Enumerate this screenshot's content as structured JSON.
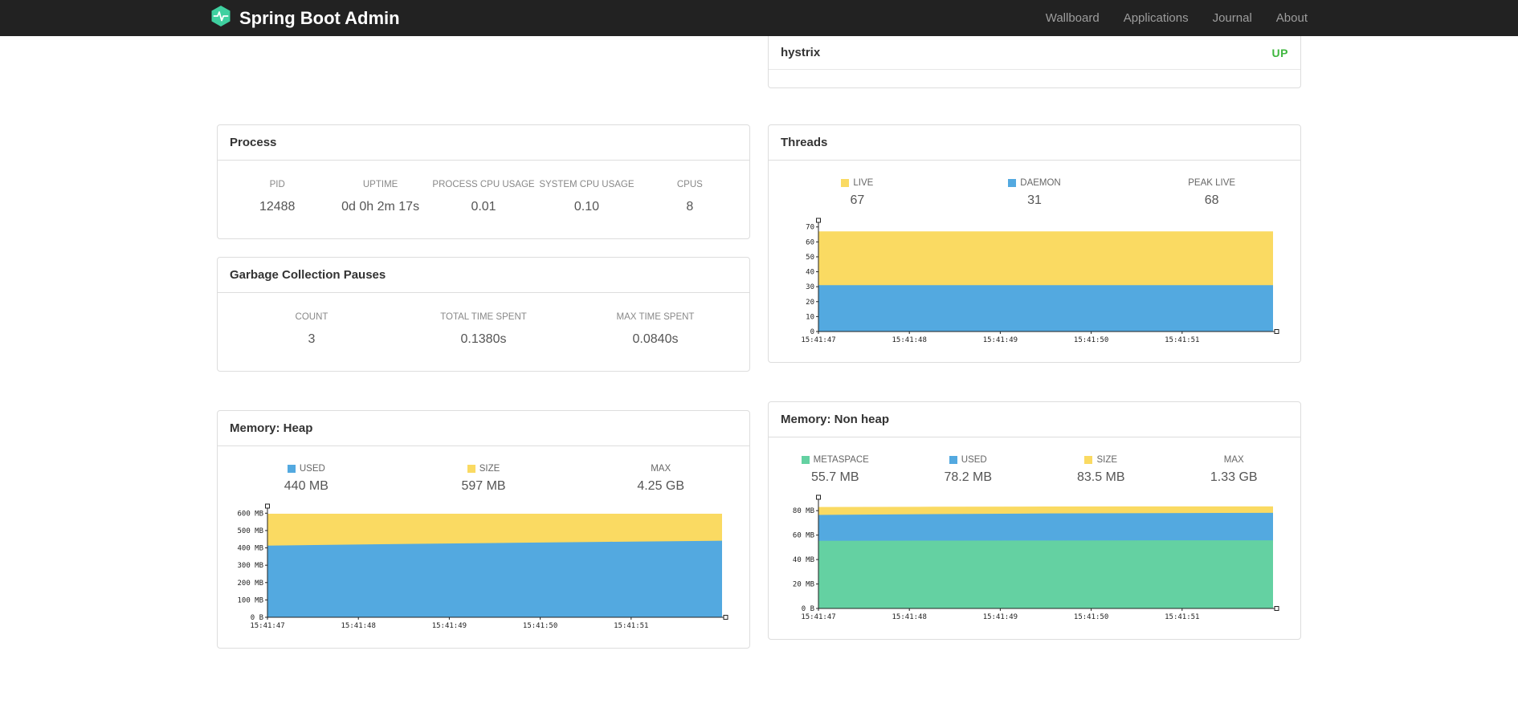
{
  "colors": {
    "yellow": "#fada62",
    "blue": "#53a9e0",
    "green": "#64d1a2",
    "up": "#3fb73f",
    "brand": "#3fd0a0"
  },
  "navbar": {
    "brand": "Spring Boot Admin",
    "links": [
      {
        "label": "Wallboard"
      },
      {
        "label": "Applications"
      },
      {
        "label": "Journal"
      },
      {
        "label": "About"
      }
    ]
  },
  "health": {
    "service": "hystrix",
    "status": "UP"
  },
  "process": {
    "title": "Process",
    "stats": [
      {
        "label": "PID",
        "value": "12488"
      },
      {
        "label": "UPTIME",
        "value": "0d 0h 2m 17s"
      },
      {
        "label": "PROCESS CPU USAGE",
        "value": "0.01"
      },
      {
        "label": "SYSTEM CPU USAGE",
        "value": "0.10"
      },
      {
        "label": "CPUS",
        "value": "8"
      }
    ]
  },
  "gc": {
    "title": "Garbage Collection Pauses",
    "stats": [
      {
        "label": "COUNT",
        "value": "3"
      },
      {
        "label": "TOTAL TIME SPENT",
        "value": "0.1380s"
      },
      {
        "label": "MAX TIME SPENT",
        "value": "0.0840s"
      }
    ]
  },
  "threads": {
    "title": "Threads",
    "legend": [
      {
        "label": "LIVE",
        "value": "67",
        "color": "#fada62"
      },
      {
        "label": "DAEMON",
        "value": "31",
        "color": "#53a9e0"
      },
      {
        "label": "PEAK LIVE",
        "value": "68"
      }
    ]
  },
  "memory_heap": {
    "title": "Memory: Heap",
    "legend": [
      {
        "label": "USED",
        "value": "440 MB",
        "color": "#53a9e0"
      },
      {
        "label": "SIZE",
        "value": "597 MB",
        "color": "#fada62"
      },
      {
        "label": "MAX",
        "value": "4.25 GB"
      }
    ]
  },
  "memory_nonheap": {
    "title": "Memory: Non heap",
    "legend": [
      {
        "label": "METASPACE",
        "value": "55.7 MB",
        "color": "#64d1a2"
      },
      {
        "label": "USED",
        "value": "78.2 MB",
        "color": "#53a9e0"
      },
      {
        "label": "SIZE",
        "value": "83.5 MB",
        "color": "#fada62"
      },
      {
        "label": "MAX",
        "value": "1.33 GB"
      }
    ]
  },
  "chart_data": [
    {
      "type": "area",
      "title": "Threads",
      "x": [
        "15:41:47",
        "15:41:48",
        "15:41:49",
        "15:41:50",
        "15:41:51"
      ],
      "ylim": [
        0,
        72
      ],
      "yticks": [
        {
          "v": 0,
          "label": "0"
        },
        {
          "v": 10,
          "label": "10"
        },
        {
          "v": 20,
          "label": "20"
        },
        {
          "v": 30,
          "label": "30"
        },
        {
          "v": 40,
          "label": "40"
        },
        {
          "v": 50,
          "label": "50"
        },
        {
          "v": 60,
          "label": "60"
        },
        {
          "v": 70,
          "label": "70"
        }
      ],
      "series": [
        {
          "name": "LIVE",
          "color": "#fada62",
          "values": [
            67,
            67,
            67,
            67,
            67
          ]
        },
        {
          "name": "DAEMON",
          "color": "#53a9e0",
          "values": [
            31,
            31,
            31,
            31,
            31
          ]
        }
      ]
    },
    {
      "type": "area",
      "title": "Memory: Heap",
      "x": [
        "15:41:47",
        "15:41:48",
        "15:41:49",
        "15:41:50",
        "15:41:51"
      ],
      "ylim": [
        0,
        620
      ],
      "yticks": [
        {
          "v": 0,
          "label": "0 B"
        },
        {
          "v": 100,
          "label": "100 MB"
        },
        {
          "v": 200,
          "label": "200 MB"
        },
        {
          "v": 300,
          "label": "300 MB"
        },
        {
          "v": 400,
          "label": "400 MB"
        },
        {
          "v": 500,
          "label": "500 MB"
        },
        {
          "v": 600,
          "label": "600 MB"
        }
      ],
      "series": [
        {
          "name": "SIZE",
          "color": "#fada62",
          "values": [
            597,
            597,
            597,
            597,
            597
          ]
        },
        {
          "name": "USED",
          "color": "#53a9e0",
          "values": [
            413,
            421,
            428,
            435,
            441
          ]
        }
      ]
    },
    {
      "type": "area",
      "title": "Memory: Non heap",
      "x": [
        "15:41:47",
        "15:41:48",
        "15:41:49",
        "15:41:50",
        "15:41:51"
      ],
      "ylim": [
        0,
        88
      ],
      "yticks": [
        {
          "v": 0,
          "label": "0 B"
        },
        {
          "v": 20,
          "label": "20 MB"
        },
        {
          "v": 40,
          "label": "40 MB"
        },
        {
          "v": 60,
          "label": "60 MB"
        },
        {
          "v": 80,
          "label": "80 MB"
        }
      ],
      "series": [
        {
          "name": "SIZE",
          "color": "#fada62",
          "values": [
            83,
            83.2,
            83.4,
            83.5,
            83.5
          ]
        },
        {
          "name": "USED",
          "color": "#53a9e0",
          "values": [
            76.5,
            77.2,
            77.7,
            78,
            78.2
          ]
        },
        {
          "name": "METASPACE",
          "color": "#64d1a2",
          "values": [
            55.3,
            55.5,
            55.6,
            55.7,
            55.7
          ]
        }
      ]
    }
  ]
}
